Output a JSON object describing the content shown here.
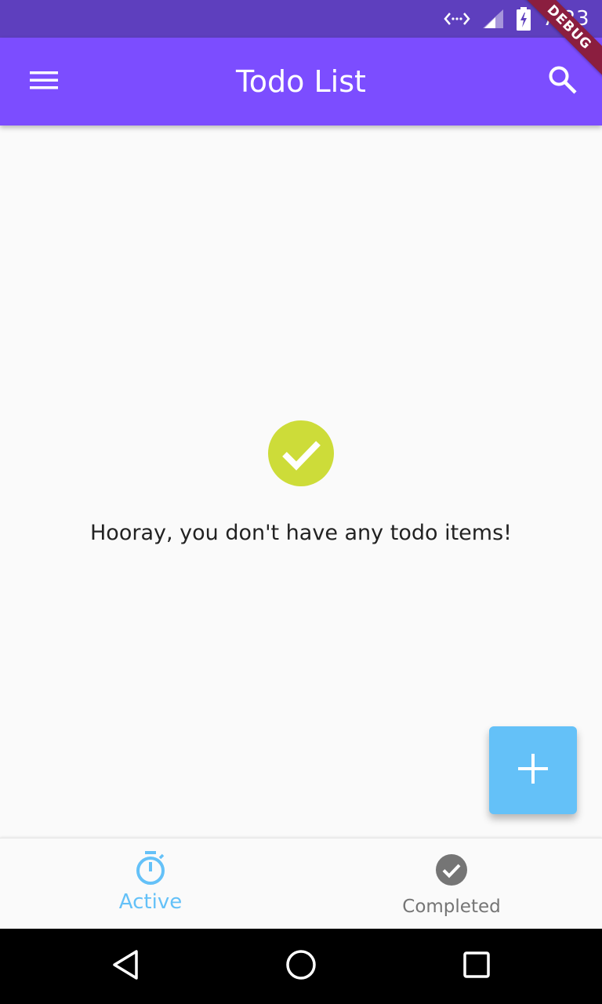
{
  "status_bar": {
    "time": "7:23",
    "icons": [
      "data-transfer-icon",
      "cell-signal-icon",
      "battery-charging-icon"
    ],
    "color": "#5e3fbe"
  },
  "debug_banner": {
    "label": "DEBUG",
    "color": "#8b1e3f"
  },
  "app_bar": {
    "title": "Todo List",
    "color": "#7c4dff",
    "leading_icon": "menu-icon",
    "trailing_icon": "search-icon"
  },
  "empty_state": {
    "icon": "check-circle-icon",
    "icon_color": "#cddc39",
    "message": "Hooray, you don't have any todo items!"
  },
  "fab": {
    "icon": "add-icon",
    "color": "#64c1f8"
  },
  "bottom_nav": {
    "tabs": [
      {
        "label": "Active",
        "icon": "timer-icon",
        "selected": true,
        "color": "#64c1f8"
      },
      {
        "label": "Completed",
        "icon": "check-circle-icon",
        "selected": false,
        "color": "#757575"
      }
    ]
  },
  "system_nav": {
    "buttons": [
      "back-icon",
      "home-icon",
      "recents-icon"
    ]
  }
}
